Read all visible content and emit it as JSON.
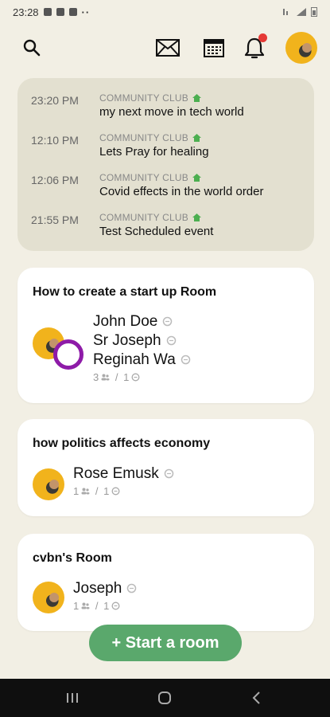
{
  "status_bar": {
    "time": "23:28"
  },
  "top_bar": {
    "icons": [
      "search-icon",
      "mail-icon",
      "calendar-icon",
      "bell-icon",
      "avatar"
    ]
  },
  "events": [
    {
      "time": "23:20 PM",
      "club": "COMMUNITY CLUB",
      "title": "my next move in tech world"
    },
    {
      "time": "12:10 PM",
      "club": "COMMUNITY CLUB",
      "title": "Lets Pray for healing"
    },
    {
      "time": "12:06 PM",
      "club": "COMMUNITY CLUB",
      "title": "Covid effects in the world order"
    },
    {
      "time": "21:55 PM",
      "club": "COMMUNITY CLUB",
      "title": "Test Scheduled event"
    }
  ],
  "rooms": [
    {
      "title": "How to  create a start up Room",
      "speakers": [
        "John Doe",
        "Sr Joseph",
        "Reginah Wa"
      ],
      "listeners": "3",
      "speakers_count": "1"
    },
    {
      "title": "how politics affects economy",
      "speakers": [
        "Rose Emusk"
      ],
      "listeners": "1",
      "speakers_count": "1"
    },
    {
      "title": "cvbn's Room",
      "speakers": [
        "Joseph"
      ],
      "listeners": "1",
      "speakers_count": "1"
    }
  ],
  "start_room": {
    "label": "+ Start a room"
  },
  "colors": {
    "background": "#f2efe4",
    "events_bg": "#e3e0d0",
    "accent_green": "#5aa86c",
    "club_home_green": "#4caf50",
    "notification_red": "#e53935",
    "ring_purple": "#8e1ba8"
  }
}
